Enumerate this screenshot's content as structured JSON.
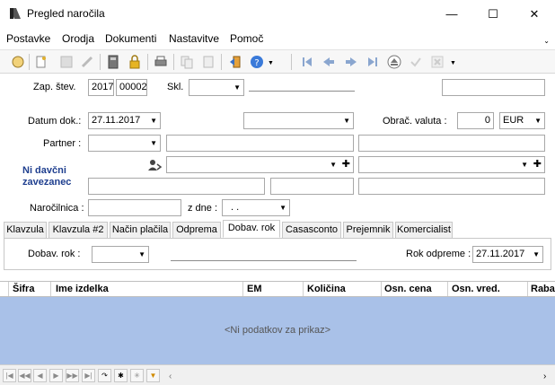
{
  "window": {
    "title": "Pregled naročila",
    "min": "—",
    "max": "☐",
    "close": "✕"
  },
  "menu": {
    "items": [
      "Postavke",
      "Orodja",
      "Dokumenti",
      "Nastavitve",
      "Pomoč"
    ],
    "more": "⌄"
  },
  "form": {
    "zap_stev_label": "Zap. štev.",
    "zap_year": "2017",
    "zap_num": "00002",
    "skl_label": "Skl.",
    "datum_label": "Datum dok.:",
    "datum_value": "27.11.2017",
    "obrac_label": "Obrač. valuta :",
    "obrac_value": "0",
    "currency": "EUR",
    "partner_label": "Partner :",
    "ni_davcni": "Ni davčni zavezanec",
    "narocilnica_label": "Naročilnica :",
    "zdne_label": "z dne :",
    "zdne_value": ". ."
  },
  "tabs": [
    "Klavzula",
    "Klavzula #2",
    "Način plačila",
    "Odprema",
    "Dobav. rok",
    "Casasconto",
    "Prejemnik",
    "Komercialist"
  ],
  "panel": {
    "dobav_label": "Dobav. rok :",
    "rok_odpreme_label": "Rok odpreme :",
    "rok_odpreme_value": "27.11.2017"
  },
  "grid": {
    "columns": [
      "Šifra",
      "Ime izdelka",
      "EM",
      "Količina",
      "Osn. cena",
      "Osn. vred.",
      "Raba"
    ],
    "empty_text": "<Ni podatkov za prikaz>"
  },
  "colors": {
    "grid_body": "#a9c1e8",
    "link_blue": "#1f3f8f"
  }
}
